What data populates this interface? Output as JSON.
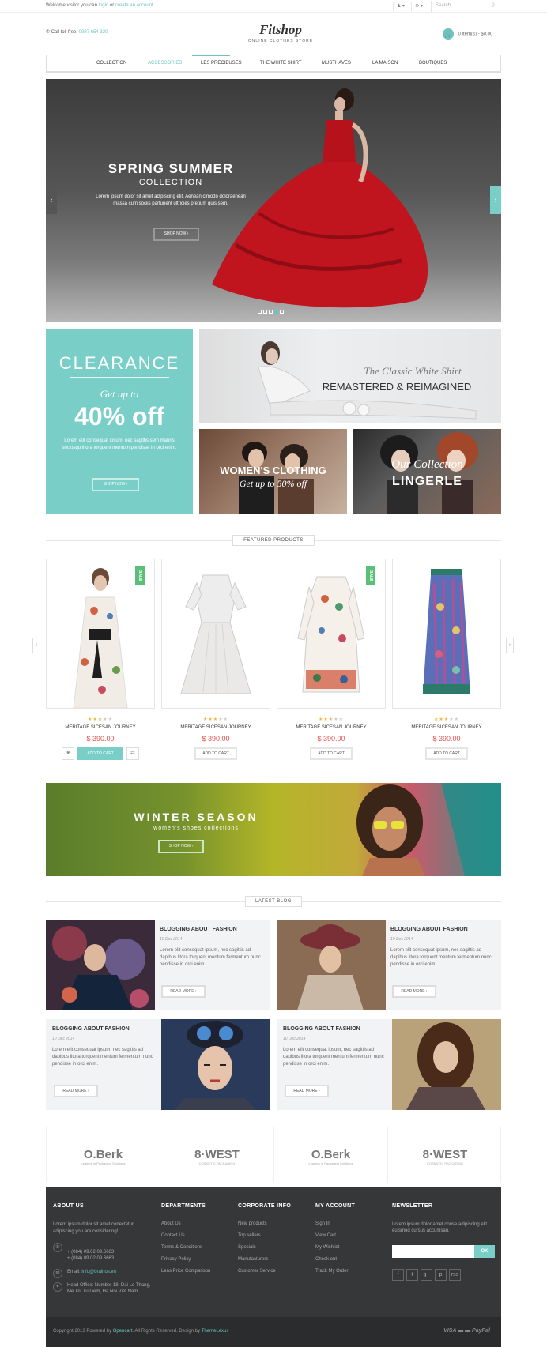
{
  "topbar": {
    "welcome": "Welcome visitor you can",
    "login": "login",
    "or": "or",
    "create": "create an account",
    "user_menu": "♟ ▾",
    "settings_menu": "⚙ ▾",
    "search_placeholder": "Search"
  },
  "header": {
    "call_label": "Call toll free:",
    "phone": "0987 654 320",
    "logo": "Fitshop",
    "tagline": "ONLINE CLOTHES STORE",
    "cart_text": "0 item(s) - $0.00"
  },
  "nav": {
    "items": [
      "COLLECTION",
      "ACCESSORIES",
      "LES PRECIEUSES",
      "THE WHITE SHIRT",
      "MUSTHAVES",
      "LA MAISON",
      "BOUTIQUES"
    ],
    "active": "ACCESSORIES"
  },
  "hero": {
    "title": "SPRING SUMMER",
    "subtitle": "COLLECTION",
    "text": "Lorem ipsum dolor sit amet adipiscing elit. Aenean clmodo doloraenean massa cum sociis parturient ultricies pretium quis sem.",
    "button": "SHOP NOW ›",
    "prev": "‹",
    "next": "›",
    "active_slide": 4
  },
  "promo": {
    "clearance": {
      "title": "CLEARANCE",
      "line": "Get up to",
      "discount": "40% off",
      "text": "Lorem elit consequat ipsum, nec sagittis sem mauris sociosqu litora torquent mentum pendisse in orci enim.",
      "button": "SHOP NOW ›"
    },
    "classic": {
      "script": "The Classic White Shirt",
      "title": "REMASTERED & REIMAGINED"
    },
    "women": {
      "title": "WOMEN'S CLOTHING",
      "sub": "Get up to 50% off"
    },
    "lingerie": {
      "script": "Our Collection",
      "title": "LINGERLE"
    }
  },
  "featured": {
    "title": "FEATURED PRODUCTS",
    "prev": "‹",
    "next": "›",
    "products": [
      {
        "name": "MERITAGE SICESAN JOURNEY",
        "price": "$ 390.00",
        "rating": 3,
        "sale": "SALE",
        "button": "ADD TO CART"
      },
      {
        "name": "MERITAGE SICESAN JOURNEY",
        "price": "$ 390.00",
        "rating": 3,
        "sale": "",
        "button": "ADD TO CART"
      },
      {
        "name": "MERITAGE SICESAN JOURNEY",
        "price": "$ 390.00",
        "rating": 3,
        "sale": "SALE",
        "button": "ADD TO CART"
      },
      {
        "name": "MERITAGE SICESAN JOURNEY",
        "price": "$ 390.00",
        "rating": 3,
        "sale": "",
        "button": "ADD TO CART"
      }
    ],
    "wishlist_icon": "♥",
    "compare_icon": "⇄"
  },
  "winter": {
    "title": "WINTER SEASON",
    "sub": "women's shoes collections",
    "button": "SHOP NOW ›"
  },
  "blog": {
    "title": "LATEST BLOG",
    "posts": [
      {
        "title": "BLOGGING ABOUT FASHION",
        "date": "10 Dec 2014",
        "text": "Lorem elit consequat ipsum, nec sagittis ad dapibus litora torquent mentum fermentum nunc pendisse in orci enim.",
        "button": "READ MORE ›"
      },
      {
        "title": "BLOGGING ABOUT FASHION",
        "date": "10 Dec 2014",
        "text": "Lorem elit consequat ipsum, nec sagittis ad dapibus litora torquent mentum fermentum nunc pendisse in orci enim.",
        "button": "READ MORE ›"
      },
      {
        "title": "BLOGGING ABOUT FASHION",
        "date": "10 Dec 2014",
        "text": "Lorem elit consequat ipsum, nec sagittis ad dapibus litora torquent mentum fermentum nunc pendisse in orci enim.",
        "button": "READ MORE ›"
      },
      {
        "title": "BLOGGING ABOUT FASHION",
        "date": "10 Dec 2014",
        "text": "Lorem elit consequat ipsum, nec sagittis ad dapibus litora torquent mentum fermentum nunc pendisse in orci enim.",
        "button": "READ MORE ›"
      }
    ]
  },
  "brands": [
    {
      "name": "O.Berk",
      "sub": "Leaders in Packaging Solutions"
    },
    {
      "name": "8·WEST",
      "sub": "COSMETIC PACKAGING"
    },
    {
      "name": "O.Berk",
      "sub": "Leaders in Packaging Solutions"
    },
    {
      "name": "8·WEST",
      "sub": "COSMETIC PACKAGING"
    }
  ],
  "footer": {
    "about": {
      "title": "ABOUT US",
      "text": "Lorem ipsum dolor sit amet conectetur adipiscing you are considering!",
      "phones": "+ (084) 09.02.09.6663\n+ (084) 09.02.09.6663",
      "email_label": "Email:",
      "email": "info@brainos.vn",
      "address": "Head Office: Number 18, Dai Lo Thang, Me Tri, Tu Liem, Ha Noi Viet Nam"
    },
    "departments": {
      "title": "DEPARTMENTS",
      "links": [
        "About Us",
        "Contact Us",
        "Terms & Conditions",
        "Privacy Policy",
        "Lens Price Comparison"
      ]
    },
    "corporate": {
      "title": "CORPORATE INFO",
      "links": [
        "New products",
        "Top sellers",
        "Specials",
        "Manufacturers",
        "Customer Service"
      ]
    },
    "account": {
      "title": "MY ACCOUNT",
      "links": [
        "Sign In",
        "View Cart",
        "My Wishlist",
        "Check out",
        "Track My Order"
      ]
    },
    "newsletter": {
      "title": "NEWSLETTER",
      "text": "Lorem ipsum dolor amet conse adipiscing elit euismod cursus accumsan.",
      "button": "OK",
      "social": [
        "f",
        "t",
        "g+",
        "p",
        "rss"
      ]
    },
    "copyright_pre": "Copyright 2013 Powered by",
    "opencart": "Opencart",
    "copyright_mid": ". All Rights Reserved.  Design by",
    "themelexus": "ThemeLexus",
    "payments": "VISA  ▬  ▬  PayPal"
  },
  "colors": {
    "accent": "#79cfc7",
    "price": "#e0514d",
    "sale": "#5bbf7a",
    "footer": "#363738"
  }
}
